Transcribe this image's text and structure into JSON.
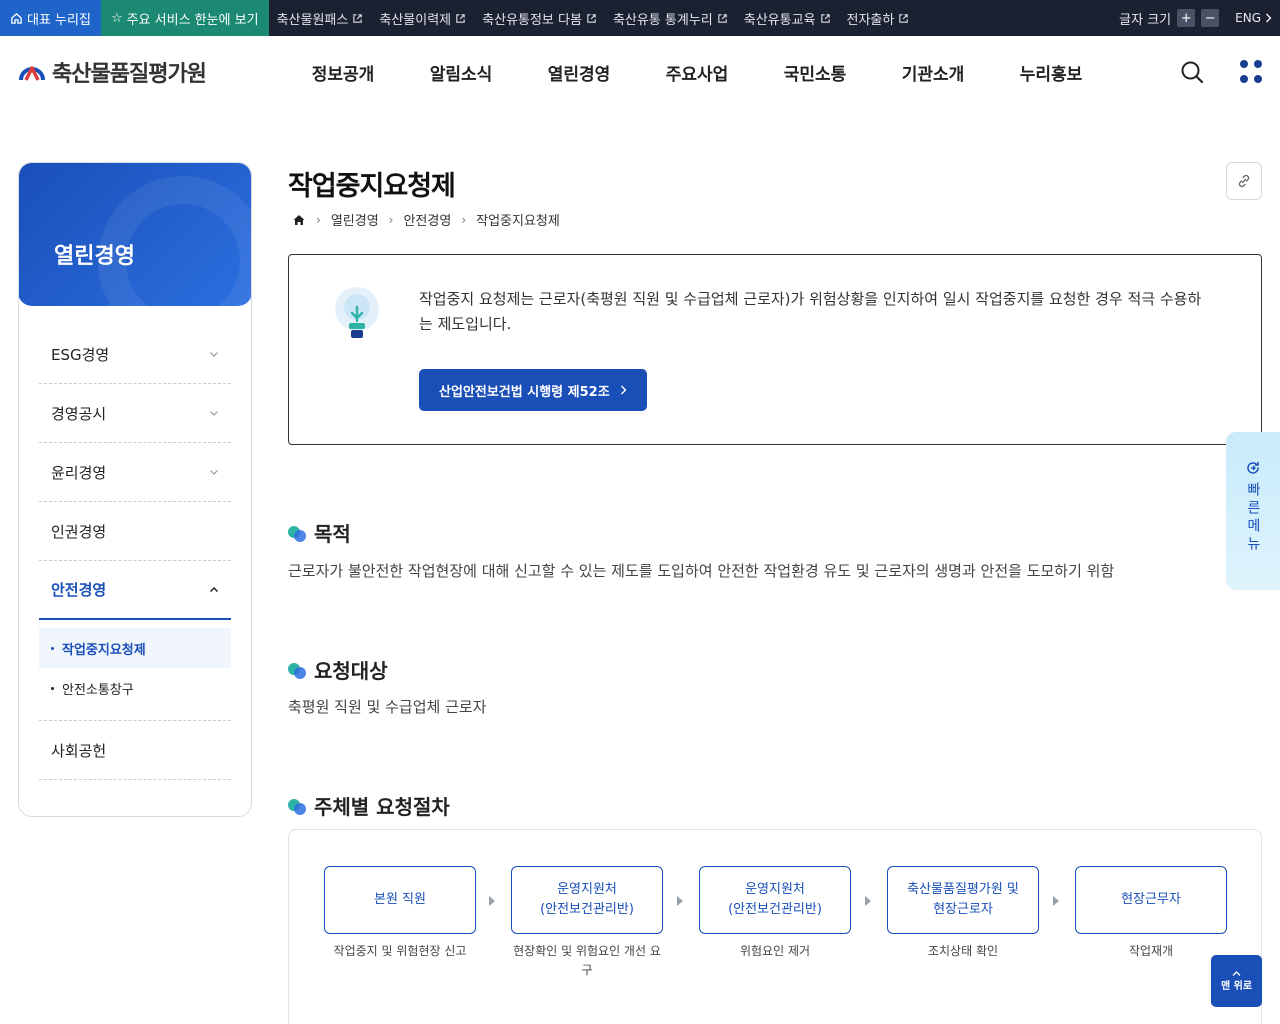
{
  "topbar": {
    "home": "대표 누리집",
    "star": "주요 서비스 한눈에 보기",
    "links": [
      "축산물원패스",
      "축산물이력제",
      "축산유통정보 다봄",
      "축산유통 통계누리",
      "축산유통교육",
      "전자출하"
    ],
    "font_size_label": "글자 크기",
    "plus": "+",
    "minus": "−",
    "lang": "ENG"
  },
  "header": {
    "logo": "축산물품질평가원",
    "nav": [
      "정보공개",
      "알림소식",
      "열린경영",
      "주요사업",
      "국민소통",
      "기관소개",
      "누리홍보"
    ]
  },
  "sidebar": {
    "title": "열린경영",
    "items": [
      {
        "label": "ESG경영"
      },
      {
        "label": "경영공시"
      },
      {
        "label": "윤리경영"
      },
      {
        "label": "인권경영"
      },
      {
        "label": "안전경영"
      },
      {
        "label": "사회공헌"
      }
    ],
    "sub": [
      "작업중지요청제",
      "안전소통창구"
    ]
  },
  "main": {
    "title": "작업중지요청제",
    "breadcrumb": [
      "열린경영",
      "안전경영",
      "작업중지요청제"
    ],
    "info_text": "작업중지 요청제는 근로자(축평원 직원 및 수급업체 근로자)가 위험상황을 인지하여 일시 작업중지를 요청한 경우 적극 수용하는 제도입니다.",
    "law_button": "산업안전보건법 시행령 제52조",
    "sections": [
      {
        "title": "목적",
        "text": "근로자가 불안전한 작업현장에 대해 신고할 수 있는 제도를 도입하여 안전한 작업환경 유도 및 근로자의 생명과 안전을 도모하기 위함"
      },
      {
        "title": "요청대상",
        "text": "축평원 직원 및 수급업체 근로자"
      },
      {
        "title": "주체별 요청절차",
        "text": ""
      }
    ],
    "process": [
      {
        "actor": "본원 직원",
        "desc": "작업중지 및 위험현장 신고"
      },
      {
        "actor": "운영지원처\n(안전보건관리반)",
        "desc": "현장확인 및 위험요인 개선 요구"
      },
      {
        "actor": "운영지원처\n(안전보건관리반)",
        "desc": "위험요인 제거"
      },
      {
        "actor": "축산물품질평가원 및\n현장근로자",
        "desc": "조치상태 확인"
      },
      {
        "actor": "현장근무자",
        "desc": "작업재개"
      }
    ]
  },
  "quick": {
    "label": "빠른메뉴"
  },
  "to_top": {
    "label": "맨 위로"
  }
}
